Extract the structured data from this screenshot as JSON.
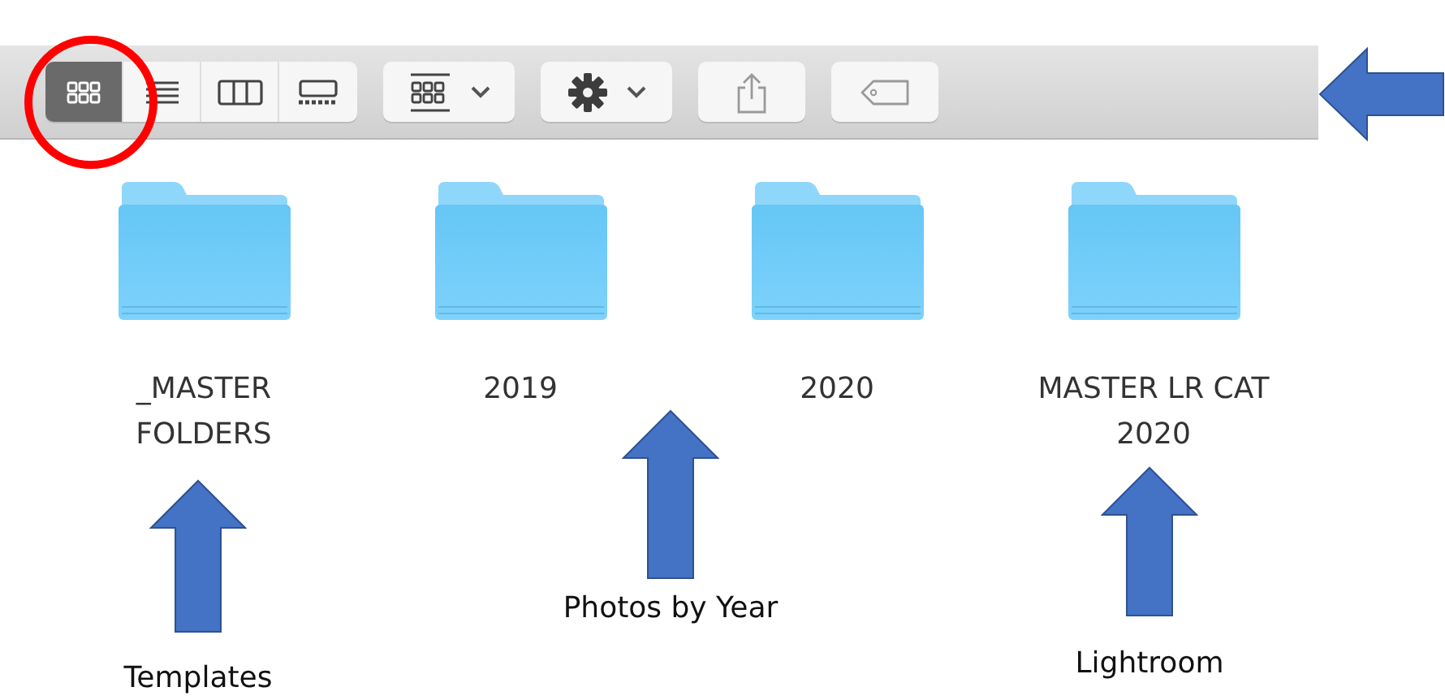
{
  "toolbar": {
    "view_buttons": [
      {
        "kind": "icons",
        "selected": true,
        "circled": true
      },
      {
        "kind": "list",
        "selected": false,
        "circled": false
      },
      {
        "kind": "columns",
        "selected": false,
        "circled": false
      },
      {
        "kind": "gallery",
        "selected": false,
        "circled": false
      }
    ],
    "buttons": [
      {
        "kind": "group",
        "menu": true
      },
      {
        "kind": "action",
        "menu": true
      },
      {
        "kind": "share",
        "menu": false
      },
      {
        "kind": "tag",
        "menu": false
      }
    ]
  },
  "folders": [
    {
      "name": "_MASTER FOLDERS"
    },
    {
      "name": "2019"
    },
    {
      "name": "2020"
    },
    {
      "name": "MASTER LR CAT 2020"
    }
  ],
  "annotations": [
    {
      "kind": "up",
      "label": "Templates"
    },
    {
      "kind": "up",
      "label": "Photos by Year"
    },
    {
      "kind": "up",
      "label": "Lightroom"
    },
    {
      "kind": "left"
    }
  ]
}
